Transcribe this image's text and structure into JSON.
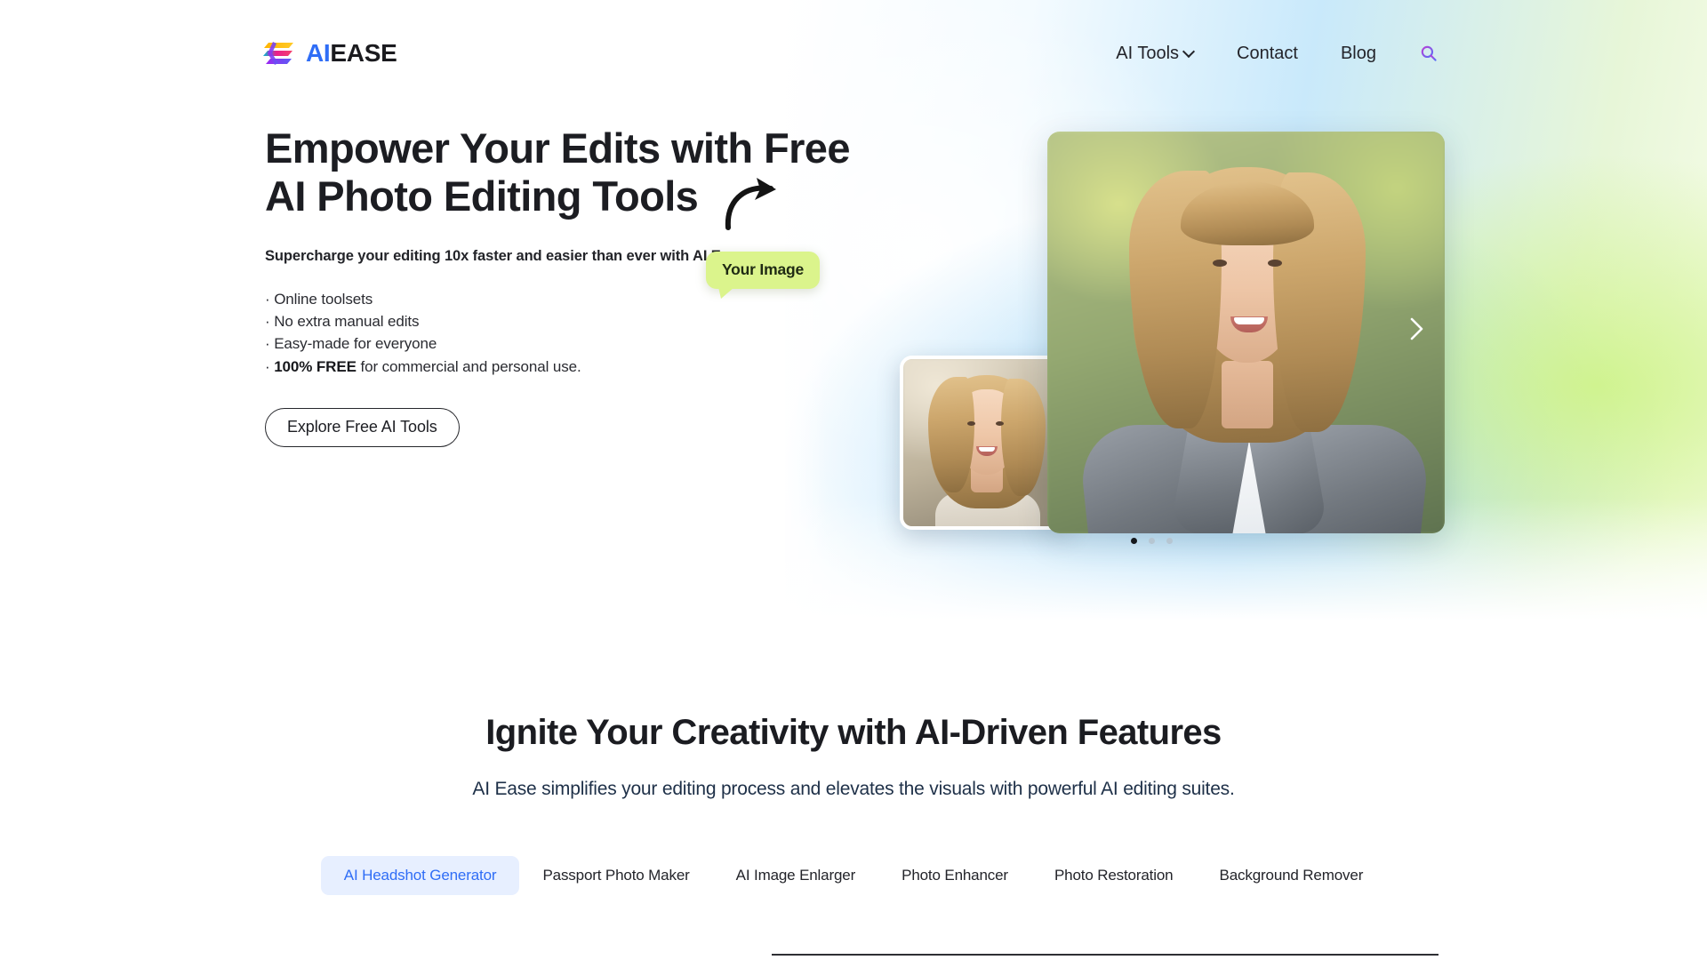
{
  "header": {
    "logo": {
      "icon": "aiease-logo-icon",
      "text_ai": "AI",
      "text_ease": "EASE"
    },
    "nav": [
      {
        "label": "AI Tools",
        "has_dropdown": true
      },
      {
        "label": "Contact",
        "has_dropdown": false
      },
      {
        "label": "Blog",
        "has_dropdown": false
      }
    ],
    "search_icon": "search-icon"
  },
  "hero": {
    "title_line1": "Empower Your Edits with Free",
    "title_line2": "AI Photo Editing Tools",
    "subtitle": "Supercharge your editing 10x faster and easier than ever with AI Ease",
    "bullets": [
      {
        "prefix": "· ",
        "text": "Online toolsets",
        "bold": ""
      },
      {
        "prefix": "· ",
        "text": "No extra manual edits",
        "bold": ""
      },
      {
        "prefix": "· ",
        "text": "Easy-made for everyone",
        "bold": ""
      },
      {
        "prefix": "· ",
        "bold": "100% FREE",
        "text": " for commercial and personal use."
      }
    ],
    "cta_label": "Explore Free AI Tools",
    "badge_label": "Your Image",
    "arrow_icon": "curved-arrow-icon",
    "next_icon": "chevron-right-icon",
    "carousel": {
      "total": 3,
      "active": 1
    }
  },
  "features": {
    "title": "Ignite Your Creativity with AI-Driven Features",
    "subtitle": "AI Ease simplifies your editing process and elevates the visuals with powerful AI editing suites.",
    "tabs": [
      {
        "label": "AI Headshot Generator",
        "active": true
      },
      {
        "label": "Passport Photo Maker",
        "active": false
      },
      {
        "label": "AI Image Enlarger",
        "active": false
      },
      {
        "label": "Photo Enhancer",
        "active": false
      },
      {
        "label": "Photo Restoration",
        "active": false
      },
      {
        "label": "Background Remover",
        "active": false
      }
    ]
  },
  "colors": {
    "brand_blue": "#2f6df6",
    "badge_green": "#dbf48c",
    "tab_active_bg": "#e7efff",
    "text_dark": "#1b1c21",
    "subtitle_navy": "#1e3048"
  }
}
